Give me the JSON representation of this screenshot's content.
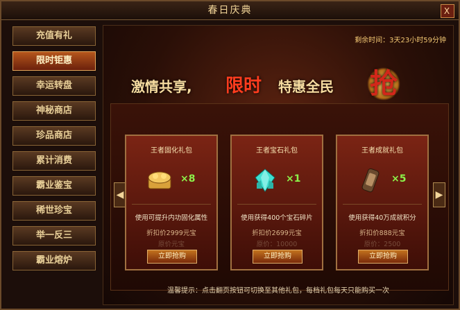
{
  "window": {
    "title": "春日庆典",
    "close_label": "X"
  },
  "sidebar": {
    "items": [
      {
        "label": "充值有礼"
      },
      {
        "label": "限时钜惠"
      },
      {
        "label": "幸运转盘"
      },
      {
        "label": "神秘商店"
      },
      {
        "label": "珍品商店"
      },
      {
        "label": "累计消费"
      },
      {
        "label": "霸业鉴宝"
      },
      {
        "label": "稀世珍宝"
      },
      {
        "label": "举一反三"
      },
      {
        "label": "霸业熔炉"
      }
    ],
    "active_index": 1
  },
  "main": {
    "timer": "剩余时间：3天23小时59分钟",
    "banner": {
      "part1": "激情共享,",
      "part2": "限时",
      "part3": "特惠全民",
      "part4": "抢"
    },
    "nav": {
      "prev": "◀",
      "next": "▶"
    },
    "cards": [
      {
        "title": "王者固化礼包",
        "count": "×8",
        "desc": "使用可提升内功固化属性",
        "price": "折扣价2999元宝",
        "orig": "原价元宝",
        "button": "立即抢购"
      },
      {
        "title": "王者宝石礼包",
        "count": "×1",
        "desc": "使用获得400个宝石碎片",
        "price": "折扣价2699元宝",
        "orig": "原价：10000",
        "button": "立即抢购"
      },
      {
        "title": "王者成就礼包",
        "count": "×5",
        "desc": "使用获得40万成就积分",
        "price": "折扣价888元宝",
        "orig": "原价：2500",
        "button": "立即抢购"
      }
    ],
    "tip": "温馨提示：点击翻页按钮可切换至其他礼包，每档礼包每天只能购买一次"
  }
}
